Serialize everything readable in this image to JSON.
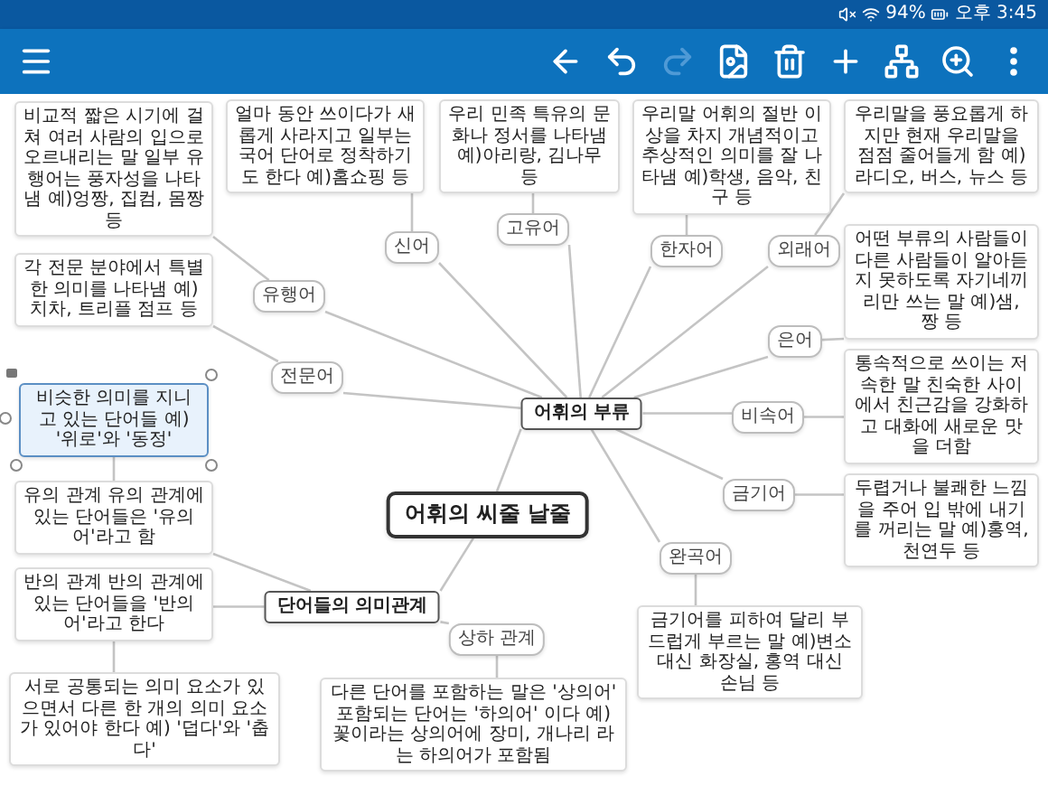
{
  "status_bar": {
    "battery": "94%",
    "time": "오후 3:45"
  },
  "toolbar": {
    "actions": [
      {
        "kind": "menu",
        "disabled": false
      },
      {
        "kind": "back",
        "disabled": false
      },
      {
        "kind": "undo",
        "disabled": false
      },
      {
        "kind": "redo",
        "disabled": true
      },
      {
        "kind": "image",
        "disabled": false
      },
      {
        "kind": "delete",
        "disabled": false
      },
      {
        "kind": "add",
        "disabled": false
      },
      {
        "kind": "tree",
        "disabled": false
      },
      {
        "kind": "zoom",
        "disabled": false
      },
      {
        "kind": "more",
        "disabled": false
      }
    ]
  },
  "mind_map": {
    "root": {
      "text": "어휘의 씨줄 날줄",
      "kind": "central",
      "selected": false,
      "children": [
        {
          "text": "어휘의 부류",
          "kind": "topic",
          "selected": false,
          "children": [
            {
              "text": "신어",
              "kind": "label",
              "selected": false,
              "children": [
                {
                  "text": "얼마 동안 쓰이다가 새롭게 사라지고 일부는 국어 단어로 정착하기도 한다 예)홈쇼핑 등",
                  "kind": "note",
                  "selected": false
                }
              ]
            },
            {
              "text": "유행어",
              "kind": "label",
              "selected": false,
              "children": [
                {
                  "text": "비교적 짧은 시기에 걸쳐 여러 사람의 입으로 오르내리는 말 일부 유행어는 풍자성을 나타냄 예)엉짱, 집컴, 몸짱 등",
                  "kind": "note",
                  "selected": false
                }
              ]
            },
            {
              "text": "전문어",
              "kind": "label",
              "selected": false,
              "children": [
                {
                  "text": "각 전문 분야에서 특별한 의미를 나타냄 예)치차, 트리플 점프 등",
                  "kind": "note",
                  "selected": false
                }
              ]
            },
            {
              "text": "고유어",
              "kind": "label",
              "selected": false,
              "children": [
                {
                  "text": "우리 민족 특유의 문화나 정서를 나타냄 예)아리랑, 김나무 등",
                  "kind": "note",
                  "selected": false
                }
              ]
            },
            {
              "text": "한자어",
              "kind": "label",
              "selected": false,
              "children": [
                {
                  "text": "우리말 어휘의 절반 이상을 차지 개념적이고 추상적인 의미를 잘 나타냄 예)학생, 음악, 친구 등",
                  "kind": "note",
                  "selected": false
                }
              ]
            },
            {
              "text": "외래어",
              "kind": "label",
              "selected": false,
              "children": [
                {
                  "text": "우리말을 풍요롭게 하지만 현재 우리말을 점점 줄어들게 함 예)라디오, 버스, 뉴스 등",
                  "kind": "note",
                  "selected": false
                }
              ]
            },
            {
              "text": "은어",
              "kind": "label",
              "selected": false,
              "children": [
                {
                  "text": "어떤 부류의 사람들이 다른 사람들이 알아듣지 못하도록 자기네끼리만 쓰는 말 예)샘, 짱 등",
                  "kind": "note",
                  "selected": false
                }
              ]
            },
            {
              "text": "비속어",
              "kind": "label",
              "selected": false,
              "children": [
                {
                  "text": "통속적으로 쓰이는 저속한 말 친숙한 사이에서 친근감을 강화하고 대화에 새로운 맛을 더함",
                  "kind": "note",
                  "selected": false
                }
              ]
            },
            {
              "text": "금기어",
              "kind": "label",
              "selected": false,
              "children": [
                {
                  "text": "두렵거나 불쾌한 느낌을 주어 입 밖에 내기를 꺼리는 말 예)홍역, 천연두 등",
                  "kind": "note",
                  "selected": false
                }
              ]
            },
            {
              "text": "완곡어",
              "kind": "label",
              "selected": false,
              "children": [
                {
                  "text": "금기어를 피하여 달리 부드럽게 부르는 말 예)변소 대신 화장실, 홍역 대신 손님 등",
                  "kind": "note",
                  "selected": false
                }
              ]
            }
          ]
        },
        {
          "text": "단어들의 의미관계",
          "kind": "topic",
          "selected": false,
          "children": [
            {
              "text": "유의 관계 유의 관계에 있는 단어들은 '유의어'라고 함",
              "kind": "note",
              "selected": false,
              "children": [
                {
                  "text": "비슷한 의미를 지니고 있는 단어들 예) '위로'와 '동정'",
                  "kind": "note",
                  "selected": true
                }
              ]
            },
            {
              "text": "반의 관계 반의 관계에 있는 단어들을 '반의어'라고 한다",
              "kind": "note",
              "selected": false,
              "children": [
                {
                  "text": "서로 공통되는 의미 요소가 있으면서 다른 한 개의 의미 요소가 있어야 한다 예) '덥다'와 '춥다'",
                  "kind": "note",
                  "selected": false
                }
              ]
            },
            {
              "text": "상하 관계",
              "kind": "label",
              "selected": false,
              "children": [
                {
                  "text": "다른 단어를 포함하는 말은 '상의어' 포함되는 단어는 '하의어' 이다 예) 꽃이라는 상의어에 장미, 개나리 라는 하의어가 포함됨",
                  "kind": "note",
                  "selected": false
                }
              ]
            }
          ]
        }
      ]
    }
  }
}
